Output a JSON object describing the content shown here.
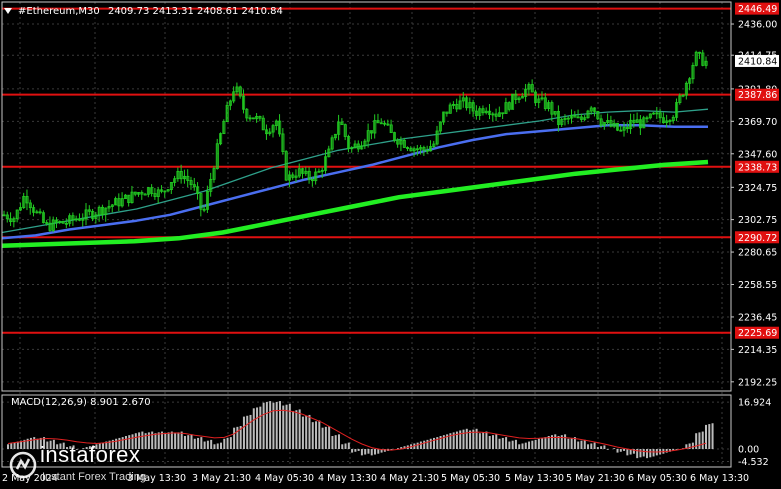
{
  "header": {
    "symbol_timeframe": "#Ethereum,M30",
    "ohlc": "2409.73 2413.31 2408.61 2410.84"
  },
  "price_axis": {
    "ticks": [
      "2436.00",
      "2414.75",
      "2391.80",
      "2369.70",
      "2347.60",
      "2324.75",
      "2302.75",
      "2280.65",
      "2258.55",
      "2236.45",
      "2214.35",
      "2192.25"
    ],
    "current_price": "2410.84",
    "levels": [
      {
        "label": "2446.49",
        "price": 2446.49
      },
      {
        "label": "2387.86",
        "price": 2387.86
      },
      {
        "label": "2338.73",
        "price": 2338.73
      },
      {
        "label": "2290.72",
        "price": 2290.72
      },
      {
        "label": "2225.69",
        "price": 2225.69
      }
    ],
    "range": [
      2186.0,
      2451.0
    ]
  },
  "time_axis": {
    "labels": [
      "2 May 2024",
      "3 May 13:30",
      "3 May 21:30",
      "4 May 05:30",
      "4 May 13:30",
      "4 May 21:30",
      "5 May 05:30",
      "5 May 13:30",
      "5 May 21:30",
      "6 May 05:30",
      "6 May 13:30"
    ]
  },
  "macd": {
    "title": "MACD(12,26,9) 8.901 2.670",
    "axis_ticks": [
      "16.924",
      "0.00",
      "-4.532"
    ],
    "range": [
      -6.5,
      19.5
    ]
  },
  "watermark": {
    "brand": "instaforex",
    "tagline": "Instant Forex Trading"
  },
  "colors": {
    "background": "#000000",
    "grid": "#3a3a3a",
    "candles": "#22cc22",
    "level_line": "#e01010",
    "ma_fast": "#2ea08a",
    "ma_mid": "#4a6ef0",
    "ma_slow": "#22ee22",
    "histogram": "#bcbcbc",
    "signal": "#e02020",
    "text": "#ffffff"
  },
  "chart_data": {
    "type": "candlestick",
    "approximate_close_path": [
      [
        2306,
        2304
      ],
      [
        2320,
        2308
      ],
      [
        2298,
        2300
      ],
      [
        2301,
        2304
      ],
      [
        2306,
        2309
      ],
      [
        2312,
        2315
      ],
      [
        2318,
        2322
      ],
      [
        2324,
        2320
      ],
      [
        2330,
        2334
      ],
      [
        2326,
        2306
      ],
      [
        2340,
        2370
      ],
      [
        2394,
        2376
      ],
      [
        2372,
        2364
      ],
      [
        2370,
        2330
      ],
      [
        2336,
        2331
      ],
      [
        2334,
        2348
      ],
      [
        2372,
        2350
      ],
      [
        2356,
        2364
      ],
      [
        2370,
        2360
      ],
      [
        2356,
        2352
      ],
      [
        2350,
        2354
      ],
      [
        2375,
        2382
      ],
      [
        2382,
        2376
      ],
      [
        2380,
        2375
      ],
      [
        2380,
        2388
      ],
      [
        2392,
        2383
      ],
      [
        2380,
        2368
      ],
      [
        2372,
        2370
      ],
      [
        2382,
        2370
      ],
      [
        2366,
        2362
      ],
      [
        2370,
        2368
      ],
      [
        2373,
        2372
      ],
      [
        2376,
        2394
      ],
      [
        2414,
        2410
      ]
    ],
    "ma_fast_path": [
      2294,
      2298,
      2302,
      2306,
      2310,
      2316,
      2322,
      2330,
      2338,
      2344,
      2350,
      2354,
      2358,
      2361,
      2364,
      2367,
      2370,
      2374,
      2376,
      2377,
      2376,
      2378
    ],
    "ma_mid_path": [
      2290,
      2292,
      2296,
      2299,
      2302,
      2306,
      2312,
      2318,
      2324,
      2330,
      2335,
      2340,
      2346,
      2352,
      2357,
      2361,
      2363,
      2365,
      2367,
      2367,
      2366,
      2366
    ],
    "ma_slow_path": [
      2285,
      2286,
      2287,
      2288,
      2290,
      2294,
      2300,
      2306,
      2312,
      2318,
      2322,
      2326,
      2330,
      2334,
      2337,
      2340,
      2342
    ],
    "macd_histogram": [
      2,
      3,
      4,
      4,
      3,
      2,
      1,
      0,
      1,
      2,
      3,
      4,
      5,
      6,
      6,
      6,
      6,
      6,
      5,
      4,
      3,
      2,
      4,
      8,
      12,
      15,
      17,
      17,
      16,
      14,
      12,
      10,
      8,
      5,
      2,
      -1,
      -2,
      -2,
      -1,
      0,
      1,
      2,
      3,
      4,
      5,
      6,
      7,
      7,
      6,
      5,
      4,
      3,
      2,
      3,
      4,
      5,
      5,
      4,
      3,
      2,
      1,
      0,
      -1,
      -2,
      -3,
      -3,
      -2,
      -1,
      0,
      2,
      6,
      9
    ],
    "macd_signal": [
      2,
      2.5,
      3,
      3.5,
      3.8,
      3.6,
      3.2,
      2.6,
      2.2,
      2.0,
      2.3,
      2.8,
      3.5,
      4.2,
      4.8,
      5.3,
      5.6,
      5.8,
      5.6,
      5.0,
      4.5,
      4.0,
      4.2,
      5.5,
      8,
      10.5,
      12.5,
      13.8,
      14,
      13.5,
      12.5,
      11,
      9.5,
      7.5,
      5.5,
      3.5,
      1.8,
      0.5,
      -0.2,
      -0.4,
      0,
      0.8,
      1.8,
      2.8,
      3.8,
      4.8,
      5.5,
      6,
      6.1,
      5.8,
      5.2,
      4.6,
      4,
      3.8,
      3.9,
      4.1,
      4.2,
      4,
      3.6,
      3,
      2.3,
      1.5,
      0.7,
      0,
      -0.6,
      -1,
      -1.1,
      -0.9,
      -0.4,
      0.2,
      1.1,
      2.1
    ]
  }
}
